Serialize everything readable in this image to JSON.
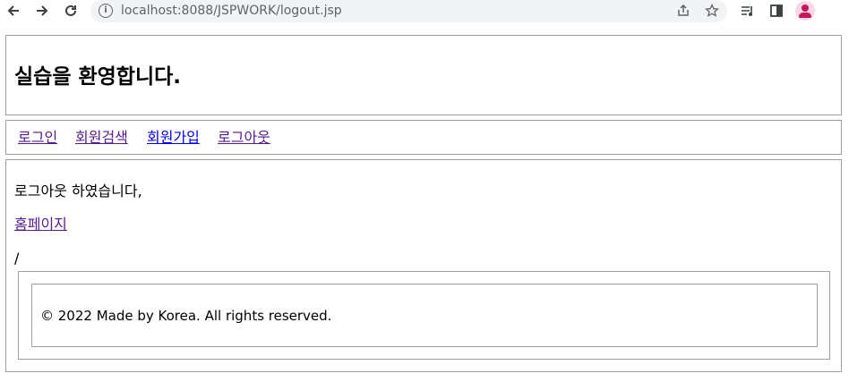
{
  "browser": {
    "url": "localhost:8088/JSPWORK/logout.jsp",
    "back_icon": "arrow-left",
    "forward_icon": "arrow-right",
    "reload_icon": "reload",
    "info_icon": "info",
    "share_icon": "share",
    "bookmark_icon": "star",
    "reading_list_icon": "reading-list",
    "side_panel_icon": "side-panel",
    "profile_icon": "person"
  },
  "header": {
    "title": "실습을 환영합니다."
  },
  "nav": {
    "items": [
      {
        "label": "로그인"
      },
      {
        "label": "회원검색"
      },
      {
        "label": "회원가입"
      },
      {
        "label": "로그아웃"
      }
    ]
  },
  "main": {
    "message": "로그아웃 하였습니다,",
    "home_link": "홈페이지",
    "separator": "/"
  },
  "footer": {
    "text": "© 2022 Made by Korea. All rights reserved."
  },
  "colors": {
    "visited_link": "#551a8b",
    "link": "#0000ee",
    "border": "#a0a0a0",
    "omnibox_bg": "#f1f3f4",
    "avatar_bg": "#f8d7e6",
    "avatar_fg": "#c2185b"
  }
}
